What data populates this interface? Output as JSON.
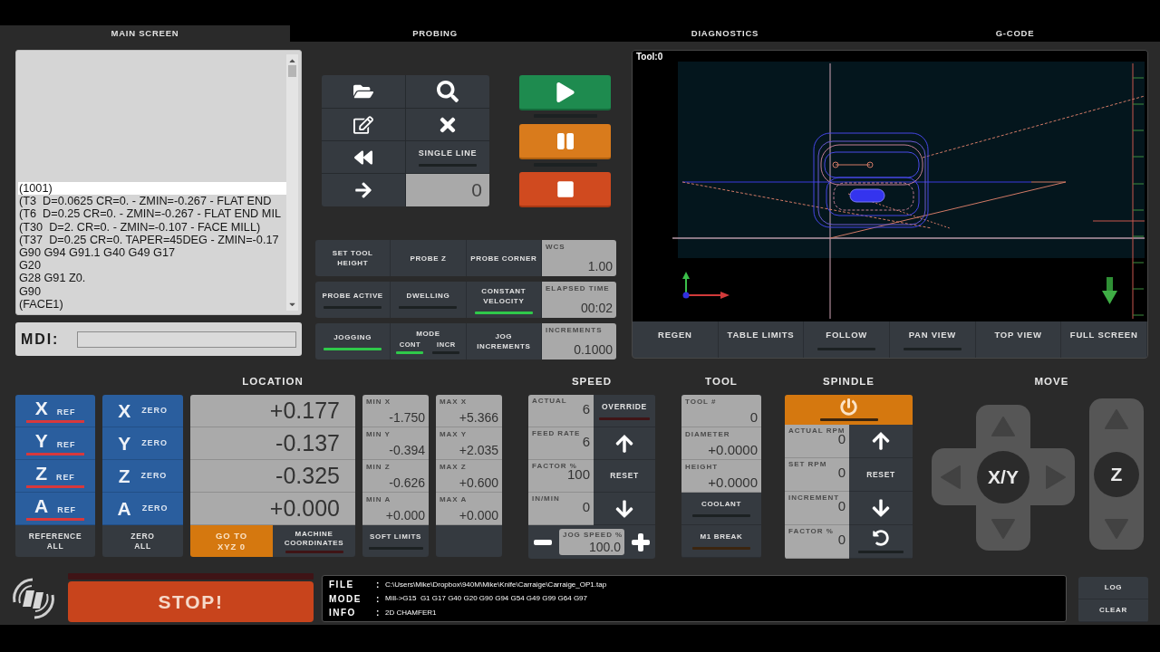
{
  "tabs": [
    {
      "label": "MAIN SCREEN",
      "selected": true
    },
    {
      "label": "PROBING",
      "selected": false
    },
    {
      "label": "DIAGNOSTICS",
      "selected": false
    },
    {
      "label": "G-CODE",
      "selected": false
    }
  ],
  "gcode": {
    "lines": [
      {
        "text": "(1001)",
        "selected": true
      },
      {
        "text": "(T3  D=0.0625 CR=0. - ZMIN=-0.267 - FLAT END",
        "selected": false
      },
      {
        "text": "(T6  D=0.25 CR=0. - ZMIN=-0.267 - FLAT END MIL",
        "selected": false
      },
      {
        "text": "(T30  D=2. CR=0. - ZMIN=-0.107 - FACE MILL)",
        "selected": false
      },
      {
        "text": "(T37  D=0.25 CR=0. TAPER=45DEG - ZMIN=-0.17",
        "selected": false
      },
      {
        "text": "G90 G94 G91.1 G40 G49 G17",
        "selected": false
      },
      {
        "text": "G20",
        "selected": false
      },
      {
        "text": "G28 G91 Z0.",
        "selected": false
      },
      {
        "text": "G90",
        "selected": false
      },
      {
        "text": "(FACE1)",
        "selected": false
      }
    ]
  },
  "mdi": {
    "label": "MDI:"
  },
  "program_controls": {
    "single_line": {
      "label": "SINGLE LINE",
      "on": false
    },
    "line_value": "0"
  },
  "run": {
    "cycle_start_lamp": false,
    "feed_hold_lamp": false
  },
  "status": {
    "rows": [
      {
        "items": [
          {
            "kind": "button",
            "label": "SET TOOL HEIGHT"
          },
          {
            "kind": "button",
            "label": "PROBE Z"
          },
          {
            "kind": "button",
            "label": "PROBE CORNER"
          }
        ],
        "readout": {
          "label": "WCS",
          "value": "1.00"
        }
      },
      {
        "items": [
          {
            "kind": "lamp",
            "label": "PROBE ACTIVE",
            "on": false
          },
          {
            "kind": "lamp",
            "label": "DWELLING",
            "on": false
          },
          {
            "kind": "lamp",
            "label": "CONSTANT VELOCITY",
            "on": true
          }
        ],
        "readout": {
          "label": "ELAPSED TIME",
          "value": "00:02"
        }
      },
      {
        "items": [
          {
            "kind": "lamp",
            "label": "JOGGING",
            "on": true
          },
          {
            "kind": "mode",
            "label": "MODE",
            "options": [
              {
                "label": "CONT",
                "selected": true
              },
              {
                "label": "INCR",
                "selected": false
              }
            ]
          },
          {
            "kind": "button",
            "label": "JOG INCREMENTS"
          }
        ],
        "readout": {
          "label": "INCREMENTS",
          "value": "0.1000"
        }
      }
    ]
  },
  "toolpath": {
    "tool": "Tool:0",
    "buttons": [
      {
        "kind": "button",
        "label": "REGEN"
      },
      {
        "kind": "button",
        "label": "TABLE LIMITS"
      },
      {
        "kind": "toggle",
        "label": "FOLLOW",
        "on": false
      },
      {
        "kind": "toggle",
        "label": "PAN VIEW",
        "on": false
      },
      {
        "kind": "button",
        "label": "TOP VIEW"
      },
      {
        "kind": "button",
        "label": "FULL SCREEN"
      }
    ]
  },
  "location": {
    "title": "LOCATION",
    "axes": [
      {
        "ref": {
          "axis": "X",
          "label": "REF",
          "referenced": false
        },
        "zero": {
          "axis": "X",
          "label": "ZERO"
        },
        "value": "+0.177",
        "min": {
          "label": "MIN X",
          "value": "-1.750"
        },
        "max": {
          "label": "MAX X",
          "value": "+5.366"
        }
      },
      {
        "ref": {
          "axis": "Y",
          "label": "REF",
          "referenced": false
        },
        "zero": {
          "axis": "Y",
          "label": "ZERO"
        },
        "value": "-0.137",
        "min": {
          "label": "MIN Y",
          "value": "-0.394"
        },
        "max": {
          "label": "MAX Y",
          "value": "+2.035"
        }
      },
      {
        "ref": {
          "axis": "Z",
          "label": "REF",
          "referenced": false
        },
        "zero": {
          "axis": "Z",
          "label": "ZERO"
        },
        "value": "-0.325",
        "min": {
          "label": "MIN Z",
          "value": "-0.626"
        },
        "max": {
          "label": "MAX Z",
          "value": "+0.600"
        }
      },
      {
        "ref": {
          "axis": "A",
          "label": "REF",
          "referenced": false
        },
        "zero": {
          "axis": "A",
          "label": "ZERO"
        },
        "value": "+0.000",
        "min": {
          "label": "MIN A",
          "value": "+0.000"
        },
        "max": {
          "label": "MAX A",
          "value": "+0.000"
        }
      }
    ],
    "reference_all": "REFERENCE ALL",
    "zero_all": "ZERO ALL",
    "go_to": "GO TO XYZ 0",
    "machine_coordinates": {
      "label": "MACHINE COORDINATES",
      "on": false
    },
    "soft_limits": {
      "label": "SOFT LIMITS",
      "on": false
    }
  },
  "speed": {
    "title": "SPEED",
    "readouts": [
      {
        "label": "ACTUAL",
        "value": "6"
      },
      {
        "label": "FEED RATE",
        "value": "6"
      },
      {
        "label": "FACTOR %",
        "value": "100"
      },
      {
        "label": "IN/MIN",
        "value": "0"
      }
    ],
    "controls": [
      {
        "kind": "toggle",
        "label": "OVERRIDE",
        "on": false
      },
      {
        "kind": "up"
      },
      {
        "kind": "text",
        "label": "RESET"
      },
      {
        "kind": "down"
      }
    ],
    "jog_speed": {
      "label": "JOG SPEED %",
      "value": "100.0"
    }
  },
  "tool": {
    "title": "TOOL",
    "readouts": [
      {
        "label": "TOOL #",
        "value": "0"
      },
      {
        "label": "DIAMETER",
        "value": "+0.0000"
      },
      {
        "label": "HEIGHT",
        "value": "+0.0000"
      }
    ],
    "toggles": [
      {
        "label": "COOLANT",
        "on": false
      },
      {
        "label": "M1 BREAK",
        "on": false
      }
    ]
  },
  "spindle": {
    "title": "SPINDLE",
    "power_on": false,
    "readouts": [
      {
        "label": "ACTUAL RPM",
        "value": "0"
      },
      {
        "label": "SET RPM",
        "value": "0"
      },
      {
        "label": "INCREMENT",
        "value": "0"
      },
      {
        "label": "FACTOR %",
        "value": "0"
      }
    ],
    "controls": [
      {
        "kind": "up"
      },
      {
        "kind": "text",
        "label": "RESET"
      },
      {
        "kind": "down"
      },
      {
        "kind": "restore",
        "on": false
      }
    ]
  },
  "move": {
    "title": "MOVE",
    "xy_label": "X/Y",
    "z_label": "Z"
  },
  "footer": {
    "stop": {
      "label": "STOP!",
      "on": false
    },
    "info": [
      {
        "label": "FILE",
        "separator": ":",
        "value": "C:\\Users\\Mike\\Dropbox\\940M\\Mike\\Knife\\Carraige\\Carraige_OP1.tap"
      },
      {
        "label": "MODE",
        "separator": ":",
        "value": "Mill->G15  G1 G17 G40 G20 G90 G94 G54 G49 G99 G64 G97"
      },
      {
        "label": "INFO",
        "separator": ":",
        "value": "2D CHAMFER1"
      }
    ],
    "buttons": [
      {
        "label": "LOG"
      },
      {
        "label": "CLEAR"
      }
    ]
  }
}
